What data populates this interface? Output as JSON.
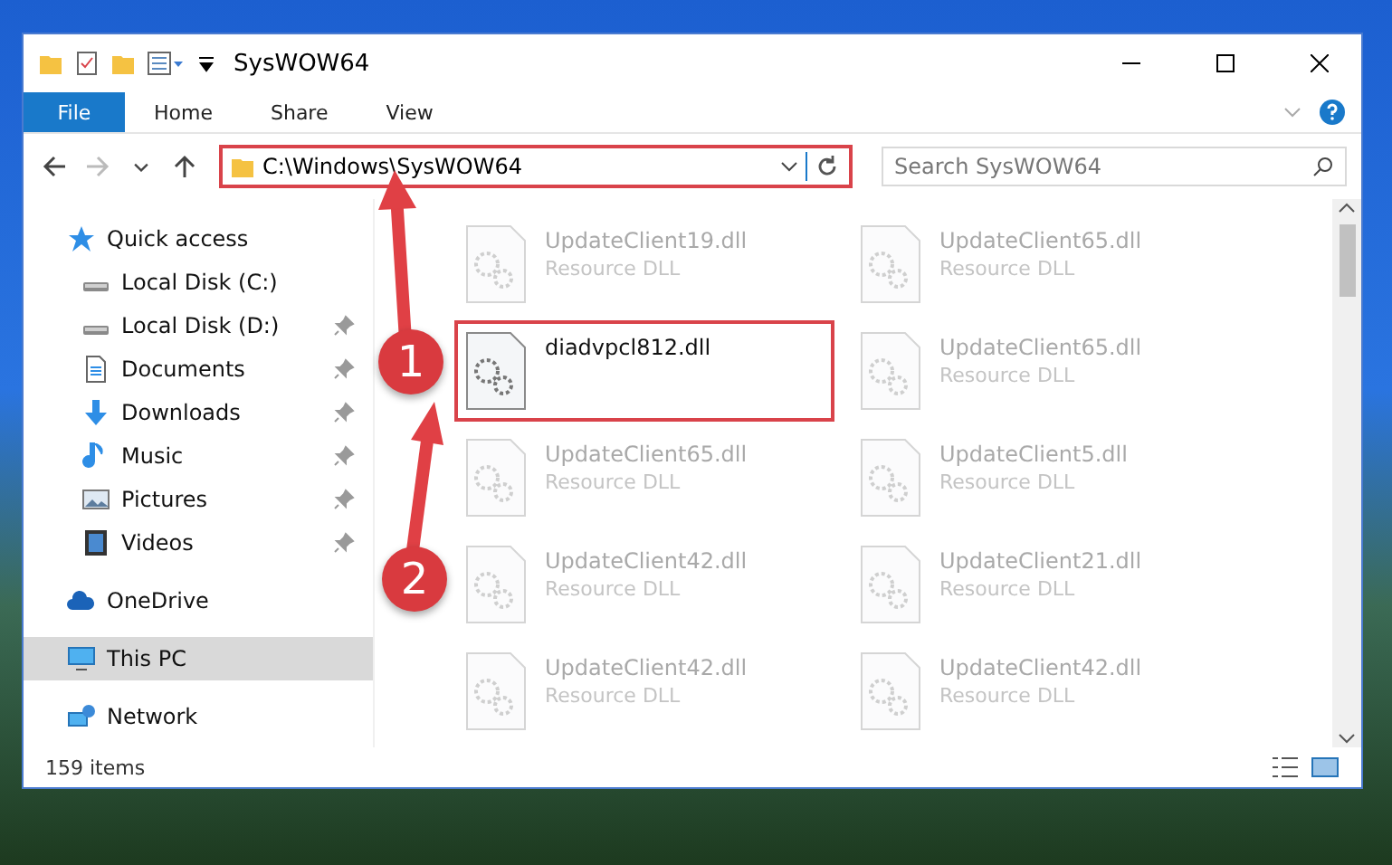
{
  "window": {
    "title": "SysWOW64"
  },
  "ribbon_tabs": [
    {
      "label": "File",
      "selected": true
    },
    {
      "label": "Home",
      "selected": false
    },
    {
      "label": "Share",
      "selected": false
    },
    {
      "label": "View",
      "selected": false
    }
  ],
  "address": {
    "path": "C:\\Windows\\SysWOW64",
    "highlighted": true
  },
  "search": {
    "placeholder": "Search SysWOW64"
  },
  "sidebar": {
    "items": [
      {
        "label": "Quick access",
        "selected": false,
        "children": [
          {
            "label": "Local Disk (C:)",
            "pinned": false,
            "selected": false
          },
          {
            "label": "Local Disk (D:)",
            "pinned": true,
            "selected": false
          },
          {
            "label": "Documents",
            "pinned": true,
            "selected": false
          },
          {
            "label": "Downloads",
            "pinned": true,
            "selected": false
          },
          {
            "label": "Music",
            "pinned": true,
            "selected": false
          },
          {
            "label": "Pictures",
            "pinned": true,
            "selected": false
          },
          {
            "label": "Videos",
            "pinned": true,
            "selected": false
          }
        ]
      },
      {
        "label": "OneDrive",
        "selected": false
      },
      {
        "label": "This PC",
        "selected": true
      },
      {
        "label": "Network",
        "selected": false
      }
    ]
  },
  "files": [
    {
      "name": "UpdateClient19.dll",
      "type": "Resource DLL",
      "dimmed": true
    },
    {
      "name": "UpdateClient65.dll",
      "type": "Resource DLL",
      "dimmed": true
    },
    {
      "name": "diadvpcl812.dll",
      "dimmed": false
    },
    {
      "name": "UpdateClient65.dll",
      "type": "Resource DLL",
      "dimmed": true
    },
    {
      "name": "UpdateClient65.dll",
      "type": "Resource DLL",
      "dimmed": true
    },
    {
      "name": "UpdateClient5.dll",
      "type": "Resource DLL",
      "dimmed": true
    },
    {
      "name": "UpdateClient42.dll",
      "type": "Resource DLL",
      "dimmed": true
    },
    {
      "name": "UpdateClient21.dll",
      "type": "Resource DLL",
      "dimmed": true
    },
    {
      "name": "UpdateClient42.dll",
      "type": "Resource DLL",
      "dimmed": true
    },
    {
      "name": "UpdateClient42.dll",
      "type": "Resource DLL",
      "dimmed": true
    }
  ],
  "status_bar": {
    "count": "159 items"
  },
  "annotations": [
    {
      "label": "1"
    },
    {
      "label": "2"
    }
  ]
}
